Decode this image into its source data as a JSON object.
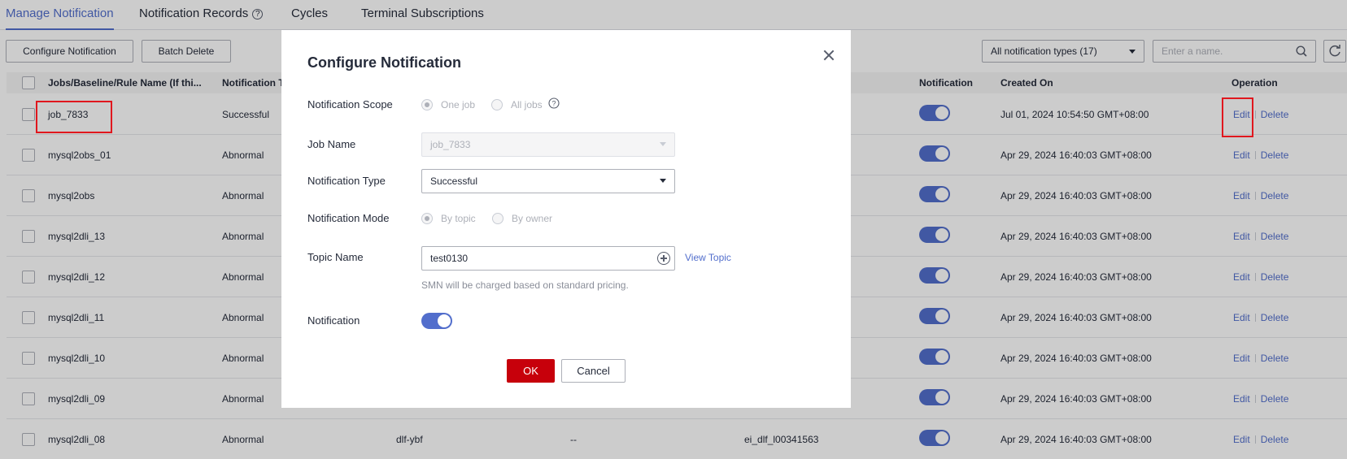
{
  "tabs": [
    {
      "label": "Manage Notification"
    },
    {
      "label": "Notification Records"
    },
    {
      "label": "Cycles"
    },
    {
      "label": "Terminal Subscriptions"
    }
  ],
  "toolbar": {
    "configure_label": "Configure Notification",
    "batch_delete_label": "Batch Delete",
    "type_filter": "All notification types (17)",
    "search_placeholder": "Enter a name."
  },
  "table": {
    "headers": {
      "name": "Jobs/Baseline/Rule Name (If thi...",
      "type": "Notification T",
      "notification": "Notification",
      "created": "Created On",
      "operation": "Operation"
    },
    "edit_label": "Edit",
    "delete_label": "Delete",
    "rows": [
      {
        "name": "job_7833",
        "type": "Successful",
        "created": "Jul 01, 2024 10:54:50 GMT+08:00",
        "c3": "",
        "c4": "",
        "c5": ""
      },
      {
        "name": "mysql2obs_01",
        "type": "Abnormal",
        "created": "Apr 29, 2024 16:40:03 GMT+08:00",
        "c3": "",
        "c4": "",
        "c5": ""
      },
      {
        "name": "mysql2obs",
        "type": "Abnormal",
        "created": "Apr 29, 2024 16:40:03 GMT+08:00",
        "c3": "",
        "c4": "",
        "c5": ""
      },
      {
        "name": "mysql2dli_13",
        "type": "Abnormal",
        "created": "Apr 29, 2024 16:40:03 GMT+08:00",
        "c3": "",
        "c4": "",
        "c5": ""
      },
      {
        "name": "mysql2dli_12",
        "type": "Abnormal",
        "created": "Apr 29, 2024 16:40:03 GMT+08:00",
        "c3": "",
        "c4": "",
        "c5": ""
      },
      {
        "name": "mysql2dli_11",
        "type": "Abnormal",
        "created": "Apr 29, 2024 16:40:03 GMT+08:00",
        "c3": "",
        "c4": "",
        "c5": ""
      },
      {
        "name": "mysql2dli_10",
        "type": "Abnormal",
        "created": "Apr 29, 2024 16:40:03 GMT+08:00",
        "c3": "",
        "c4": "",
        "c5": ""
      },
      {
        "name": "mysql2dli_09",
        "type": "Abnormal",
        "created": "Apr 29, 2024 16:40:03 GMT+08:00",
        "c3": "",
        "c4": "",
        "c5": ""
      },
      {
        "name": "mysql2dli_08",
        "type": "Abnormal",
        "created": "Apr 29, 2024 16:40:03 GMT+08:00",
        "c3": "dlf-ybf",
        "c4": "--",
        "c5": "ei_dlf_l00341563"
      }
    ]
  },
  "dialog": {
    "title": "Configure Notification",
    "scope_label": "Notification Scope",
    "scope_one": "One job",
    "scope_all": "All jobs",
    "job_name_label": "Job Name",
    "job_name_value": "job_7833",
    "type_label": "Notification Type",
    "type_value": "Successful",
    "mode_label": "Notification Mode",
    "mode_topic": "By topic",
    "mode_owner": "By owner",
    "topic_label": "Topic Name",
    "topic_value": "test0130",
    "view_topic": "View Topic",
    "note": "SMN will be charged based on standard pricing.",
    "notification_label": "Notification",
    "ok_label": "OK",
    "cancel_label": "Cancel"
  },
  "colors": {
    "accent": "#526ecc",
    "primary_button": "#c7000b",
    "highlight": "#e0171e"
  }
}
